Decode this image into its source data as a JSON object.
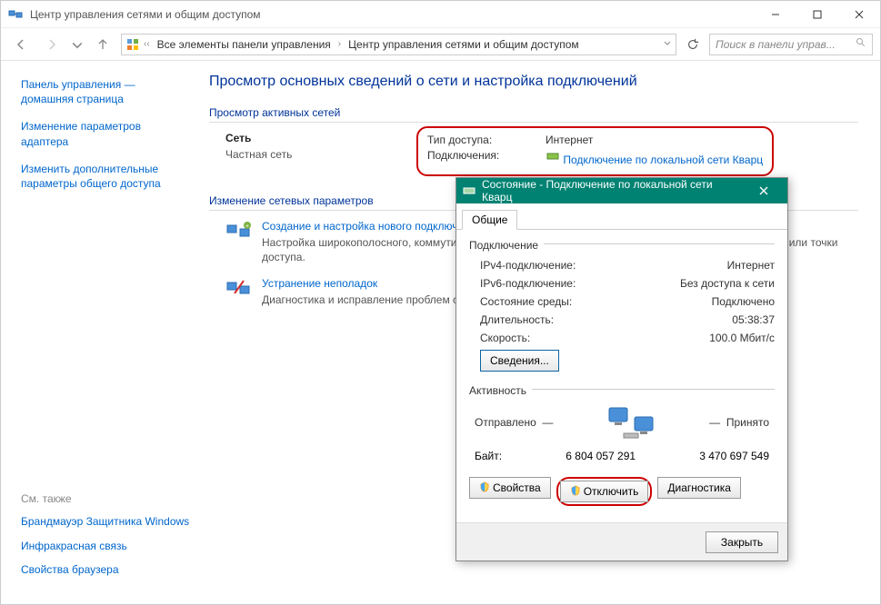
{
  "window": {
    "title": "Центр управления сетями и общим доступом"
  },
  "breadcrumb": {
    "root_icon": "control-panel-icon",
    "items": [
      "Все элементы панели управления",
      "Центр управления сетями и общим доступом"
    ]
  },
  "search": {
    "placeholder": "Поиск в панели управ..."
  },
  "sidebar": {
    "links": [
      "Панель управления — домашняя страница",
      "Изменение параметров адаптера",
      "Изменить дополнительные параметры общего доступа"
    ],
    "see_also_heading": "См. также",
    "see_also": [
      "Брандмауэр Защитника Windows",
      "Инфракрасная связь",
      "Свойства браузера"
    ]
  },
  "content": {
    "heading": "Просмотр основных сведений о сети и настройка подключений",
    "active_networks_label": "Просмотр активных сетей",
    "network": {
      "name": "Сеть",
      "type": "Частная сеть",
      "access_type_label": "Тип доступа:",
      "access_type_value": "Интернет",
      "connections_label": "Подключения:",
      "connections_value": "Подключение по локальной сети Кварц"
    },
    "change_settings_label": "Изменение сетевых параметров",
    "items": [
      {
        "link": "Создание и настройка нового подключения или сети",
        "desc": "Настройка широкополосного, коммутируемого или VPN-подключения либо настройка маршрутизатора или точки доступа."
      },
      {
        "link": "Устранение неполадок",
        "desc": "Диагностика и исправление проблем с сетью или получение сведений об устранении неполадок."
      }
    ]
  },
  "dialog": {
    "title": "Состояние - Подключение по локальной сети Кварц",
    "tab": "Общие",
    "connection_label": "Подключение",
    "rows": {
      "ipv4_label": "IPv4-подключение:",
      "ipv4_value": "Интернет",
      "ipv6_label": "IPv6-подключение:",
      "ipv6_value": "Без доступа к сети",
      "media_label": "Состояние среды:",
      "media_value": "Подключено",
      "duration_label": "Длительность:",
      "duration_value": "05:38:37",
      "speed_label": "Скорость:",
      "speed_value": "100.0 Мбит/с"
    },
    "details_button": "Сведения...",
    "activity_label": "Активность",
    "sent_label": "Отправлено",
    "received_label": "Принято",
    "bytes_label": "Байт:",
    "bytes_sent": "6 804 057 291",
    "bytes_received": "3 470 697 549",
    "properties_button": "Свойства",
    "disable_button": "Отключить",
    "diagnose_button": "Диагностика",
    "close_button": "Закрыть"
  }
}
